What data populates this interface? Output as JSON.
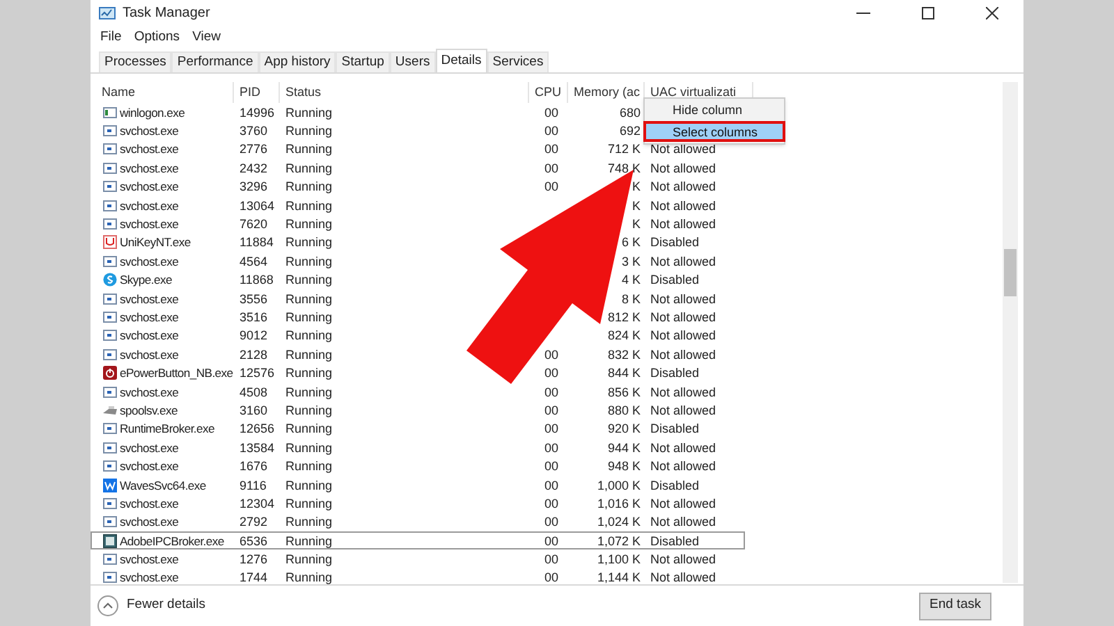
{
  "window": {
    "title": "Task Manager"
  },
  "menu": [
    "File",
    "Options",
    "View"
  ],
  "tabs": [
    {
      "label": "Processes",
      "selected": false
    },
    {
      "label": "Performance",
      "selected": false
    },
    {
      "label": "App history",
      "selected": false
    },
    {
      "label": "Startup",
      "selected": false
    },
    {
      "label": "Users",
      "selected": false
    },
    {
      "label": "Details",
      "selected": true
    },
    {
      "label": "Services",
      "selected": false
    }
  ],
  "table": {
    "columns": [
      "Name",
      "PID",
      "Status",
      "CPU",
      "Memory (ac",
      "UAC virtualizati"
    ],
    "rows": [
      {
        "kind": "app",
        "name": "winlogon.exe",
        "pid": "14996",
        "status": "Running",
        "cpu": "00",
        "memory": "680",
        "selected": false
      },
      {
        "kind": "service",
        "name": "svchost.exe",
        "pid": "3760",
        "status": "Running",
        "cpu": "00",
        "memory": "692",
        "selected": false
      },
      {
        "kind": "service",
        "name": "svchost.exe",
        "pid": "2776",
        "status": "Running",
        "cpu": "00",
        "memory": "712 K",
        "uac": "Not allowed",
        "selected": false
      },
      {
        "kind": "service",
        "name": "svchost.exe",
        "pid": "2432",
        "status": "Running",
        "cpu": "00",
        "memory": "748 K",
        "uac": "Not allowed",
        "selected": false
      },
      {
        "kind": "service",
        "name": "svchost.exe",
        "pid": "3296",
        "status": "Running",
        "cpu": "00",
        "memory": "K",
        "uac": "Not allowed",
        "selected": false
      },
      {
        "kind": "service",
        "name": "svchost.exe",
        "pid": "13064",
        "status": "Running",
        "memory": "K",
        "uac": "Not allowed",
        "selected": false
      },
      {
        "kind": "service",
        "name": "svchost.exe",
        "pid": "7620",
        "status": "Running",
        "memory": "K",
        "uac": "Not allowed",
        "selected": false
      },
      {
        "kind": "unikey",
        "name": "UniKeyNT.exe",
        "pid": "11884",
        "status": "Running",
        "memory": "6 K",
        "uac": "Disabled",
        "selected": false
      },
      {
        "kind": "service",
        "name": "svchost.exe",
        "pid": "4564",
        "status": "Running",
        "memory": "3 K",
        "uac": "Not allowed",
        "selected": false
      },
      {
        "kind": "skype",
        "name": "Skype.exe",
        "pid": "11868",
        "status": "Running",
        "memory": "4 K",
        "uac": "Disabled",
        "selected": false
      },
      {
        "kind": "service",
        "name": "svchost.exe",
        "pid": "3556",
        "status": "Running",
        "memory": "8 K",
        "uac": "Not allowed",
        "selected": false
      },
      {
        "kind": "service",
        "name": "svchost.exe",
        "pid": "3516",
        "status": "Running",
        "memory": "812 K",
        "uac": "Not allowed",
        "selected": false
      },
      {
        "kind": "service",
        "name": "svchost.exe",
        "pid": "9012",
        "status": "Running",
        "memory": "824 K",
        "uac": "Not allowed",
        "selected": false
      },
      {
        "kind": "service",
        "name": "svchost.exe",
        "pid": "2128",
        "status": "Running",
        "cpu": "00",
        "memory": "832 K",
        "uac": "Not allowed",
        "selected": false
      },
      {
        "kind": "power",
        "name": "ePowerButton_NB.exe",
        "pid": "12576",
        "status": "Running",
        "cpu": "00",
        "memory": "844 K",
        "uac": "Disabled",
        "selected": false
      },
      {
        "kind": "service",
        "name": "svchost.exe",
        "pid": "4508",
        "status": "Running",
        "cpu": "00",
        "memory": "856 K",
        "uac": "Not allowed",
        "selected": false
      },
      {
        "kind": "printer",
        "name": "spoolsv.exe",
        "pid": "3160",
        "status": "Running",
        "cpu": "00",
        "memory": "880 K",
        "uac": "Not allowed",
        "selected": false
      },
      {
        "kind": "service",
        "name": "RuntimeBroker.exe",
        "pid": "12656",
        "status": "Running",
        "cpu": "00",
        "memory": "920 K",
        "uac": "Disabled",
        "selected": false
      },
      {
        "kind": "service",
        "name": "svchost.exe",
        "pid": "13584",
        "status": "Running",
        "cpu": "00",
        "memory": "944 K",
        "uac": "Not allowed",
        "selected": false
      },
      {
        "kind": "service",
        "name": "svchost.exe",
        "pid": "1676",
        "status": "Running",
        "cpu": "00",
        "memory": "948 K",
        "uac": "Not allowed",
        "selected": false
      },
      {
        "kind": "waves",
        "name": "WavesSvc64.exe",
        "pid": "9116",
        "status": "Running",
        "cpu": "00",
        "memory": "1,000 K",
        "uac": "Disabled",
        "selected": false
      },
      {
        "kind": "service",
        "name": "svchost.exe",
        "pid": "12304",
        "status": "Running",
        "cpu": "00",
        "memory": "1,016 K",
        "uac": "Not allowed",
        "selected": false
      },
      {
        "kind": "service",
        "name": "svchost.exe",
        "pid": "2792",
        "status": "Running",
        "cpu": "00",
        "memory": "1,024 K",
        "uac": "Not allowed",
        "selected": false
      },
      {
        "kind": "adobe",
        "name": "AdobeIPCBroker.exe",
        "pid": "6536",
        "status": "Running",
        "cpu": "00",
        "memory": "1,072 K",
        "uac": "Disabled",
        "selected": true
      },
      {
        "kind": "service",
        "name": "svchost.exe",
        "pid": "1276",
        "status": "Running",
        "cpu": "00",
        "memory": "1,100 K",
        "uac": "Not allowed",
        "selected": false
      },
      {
        "kind": "service",
        "name": "svchost.exe",
        "pid": "1744",
        "status": "Running",
        "cpu": "00",
        "memory": "1,144 K",
        "uac": "Not allowed",
        "selected": false
      }
    ]
  },
  "context_menu": [
    {
      "label": "Hide column",
      "selected": false
    },
    {
      "label": "Select columns",
      "selected": true
    }
  ],
  "footer": {
    "toggle": "Fewer details",
    "button": "End task"
  }
}
